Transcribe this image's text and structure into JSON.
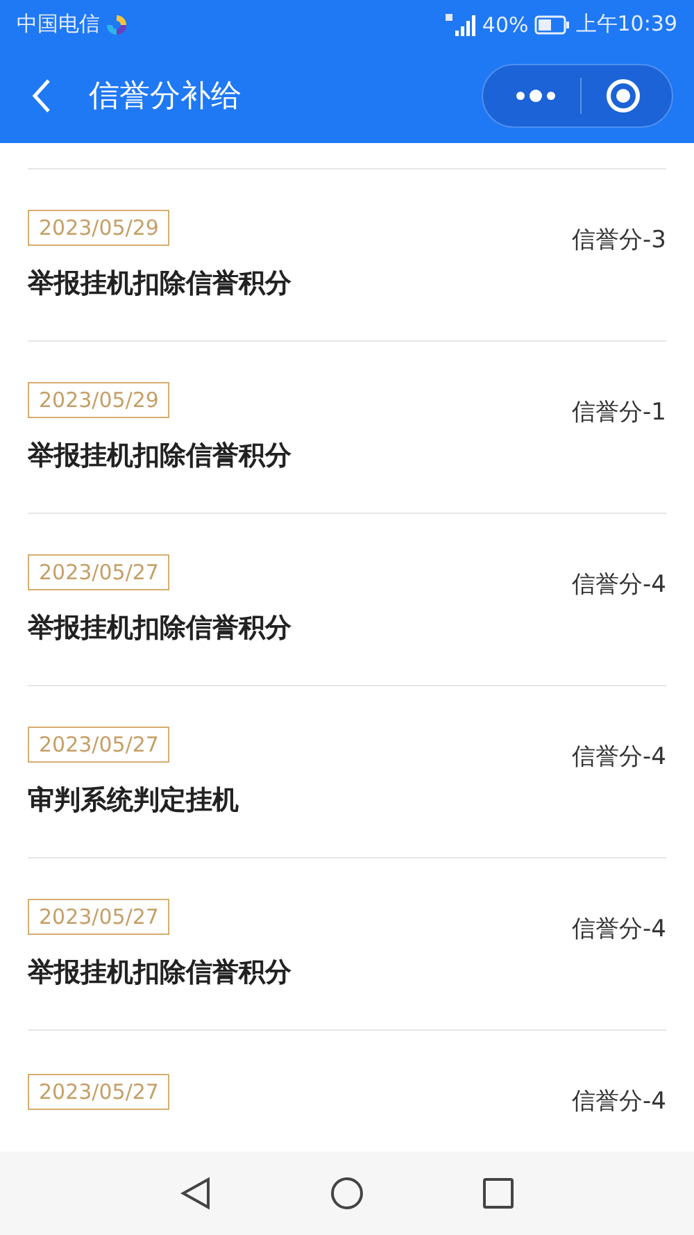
{
  "status_bar": {
    "carrier": "中国电信",
    "battery": "40%",
    "time": "上午10:39"
  },
  "header": {
    "title": "信誉分补给"
  },
  "records": [
    {
      "date": "2023/05/29",
      "title": "举报挂机扣除信誉积分",
      "score": "信誉分-3"
    },
    {
      "date": "2023/05/29",
      "title": "举报挂机扣除信誉积分",
      "score": "信誉分-1"
    },
    {
      "date": "2023/05/27",
      "title": "举报挂机扣除信誉积分",
      "score": "信誉分-4"
    },
    {
      "date": "2023/05/27",
      "title": "审判系统判定挂机",
      "score": "信誉分-4"
    },
    {
      "date": "2023/05/27",
      "title": "举报挂机扣除信誉积分",
      "score": "信誉分-4"
    },
    {
      "date": "2023/05/27",
      "score": "信誉分-4"
    }
  ]
}
